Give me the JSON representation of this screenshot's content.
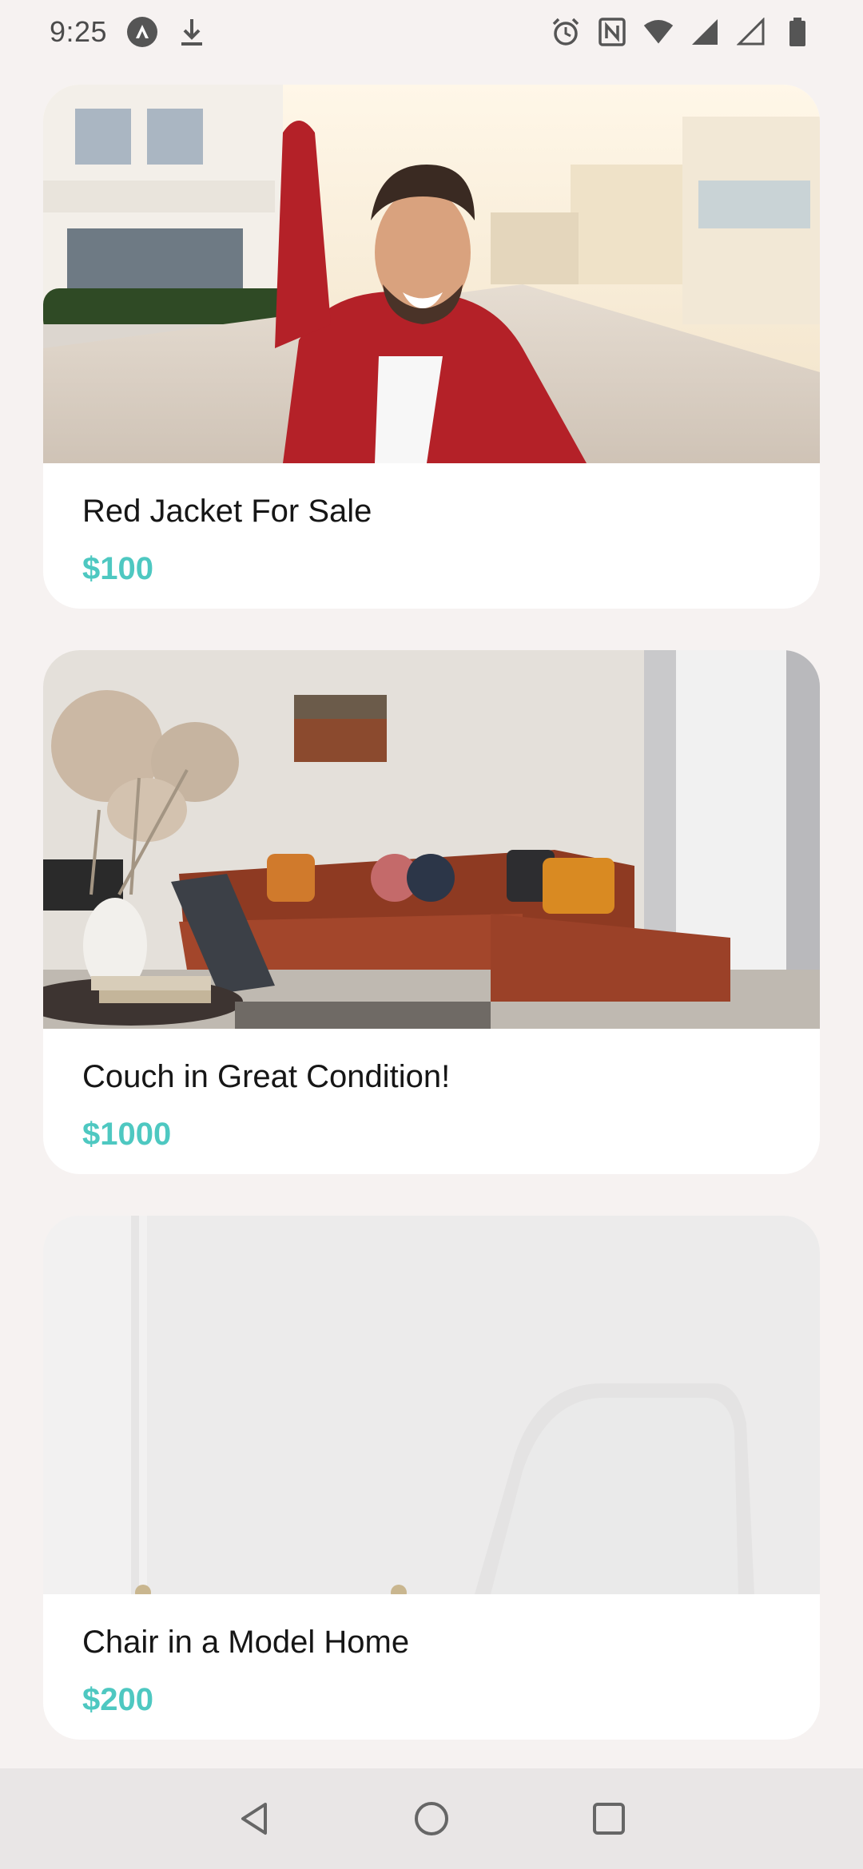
{
  "status_bar": {
    "time": "9:25",
    "left_icons": [
      "app-a-icon",
      "download-icon"
    ],
    "right_icons": [
      "alarm-icon",
      "nfc-icon",
      "wifi-icon",
      "signal-icon",
      "signal-empty-icon",
      "battery-icon"
    ]
  },
  "listings": [
    {
      "title": "Red Jacket For Sale",
      "price": "$100",
      "image": "photo of smiling man in red jacket taking selfie on street"
    },
    {
      "title": "Couch in Great Condition!",
      "price": "$1000",
      "image": "photo of rust colored sectional sofa in living room"
    },
    {
      "title": "Chair in a Model Home",
      "price": "$200",
      "image": "photo of white chair against pale wall"
    }
  ],
  "colors": {
    "background": "#f6f2f1",
    "price_accent": "#4ec8c1",
    "card": "#ffffff",
    "nav_bar": "#e9e6e6"
  },
  "nav_bar": {
    "buttons": [
      "back-icon",
      "home-icon",
      "recents-icon"
    ]
  }
}
